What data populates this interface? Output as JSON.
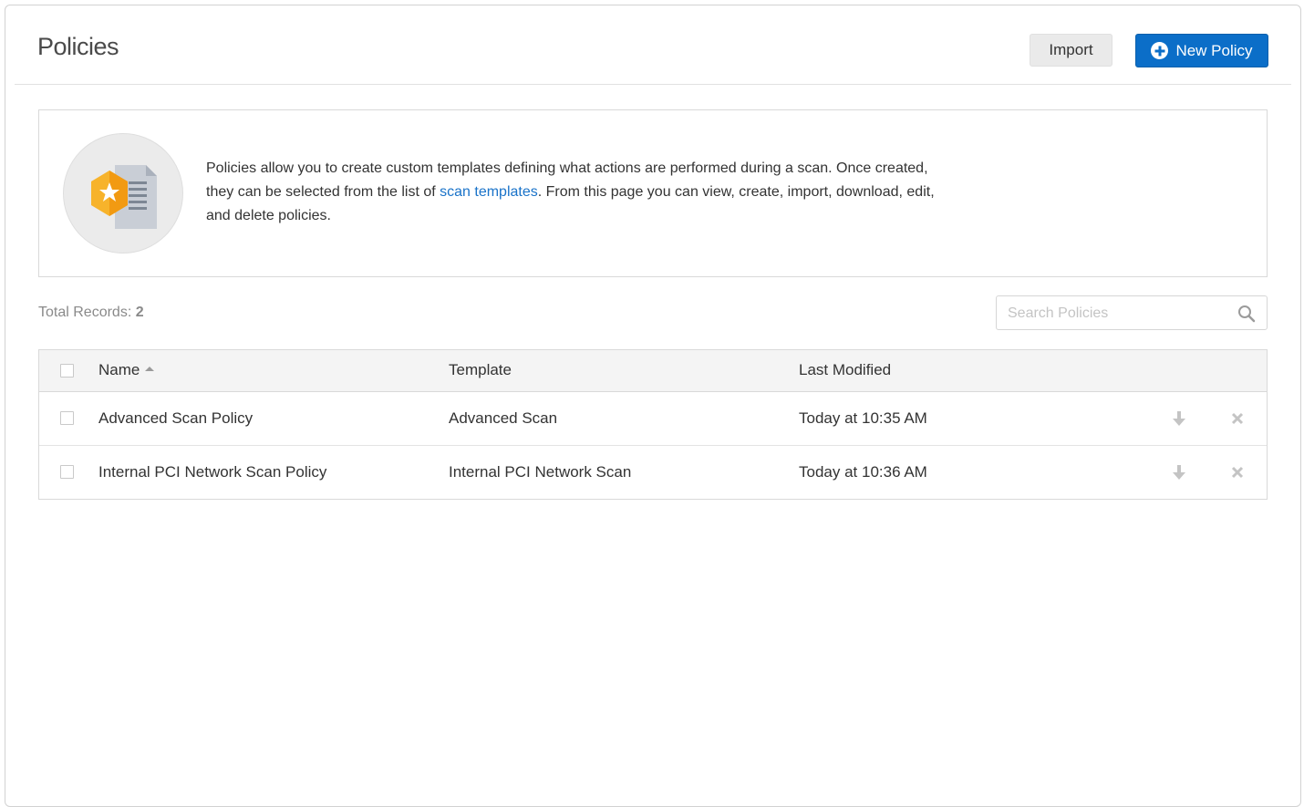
{
  "header": {
    "title": "Policies",
    "import_label": "Import",
    "new_policy_label": "New Policy"
  },
  "info": {
    "text_before": "Policies allow you to create custom templates defining what actions are performed during a scan. Once created, they can be selected from the list of ",
    "link_text": "scan templates",
    "text_after": ". From this page you can view, create, import, download, edit, and delete policies."
  },
  "records": {
    "label": "Total Records: ",
    "count": "2"
  },
  "search": {
    "placeholder": "Search Policies"
  },
  "table": {
    "columns": {
      "name": "Name",
      "template": "Template",
      "modified": "Last Modified"
    },
    "rows": [
      {
        "name": "Advanced Scan Policy",
        "template": "Advanced Scan",
        "modified": "Today at 10:35 AM"
      },
      {
        "name": "Internal PCI Network Scan Policy",
        "template": "Internal PCI Network Scan",
        "modified": "Today at 10:36 AM"
      }
    ]
  },
  "colors": {
    "primary": "#0b6ec8",
    "link": "#1a73c9",
    "badge": "#f5a623"
  },
  "icons": {
    "new_policy": "plus-circle-icon",
    "policy_graphic": "shield-star-document-icon",
    "search": "search-icon",
    "download": "download-arrow-icon",
    "delete": "close-icon",
    "sort": "sort-ascending-icon"
  }
}
